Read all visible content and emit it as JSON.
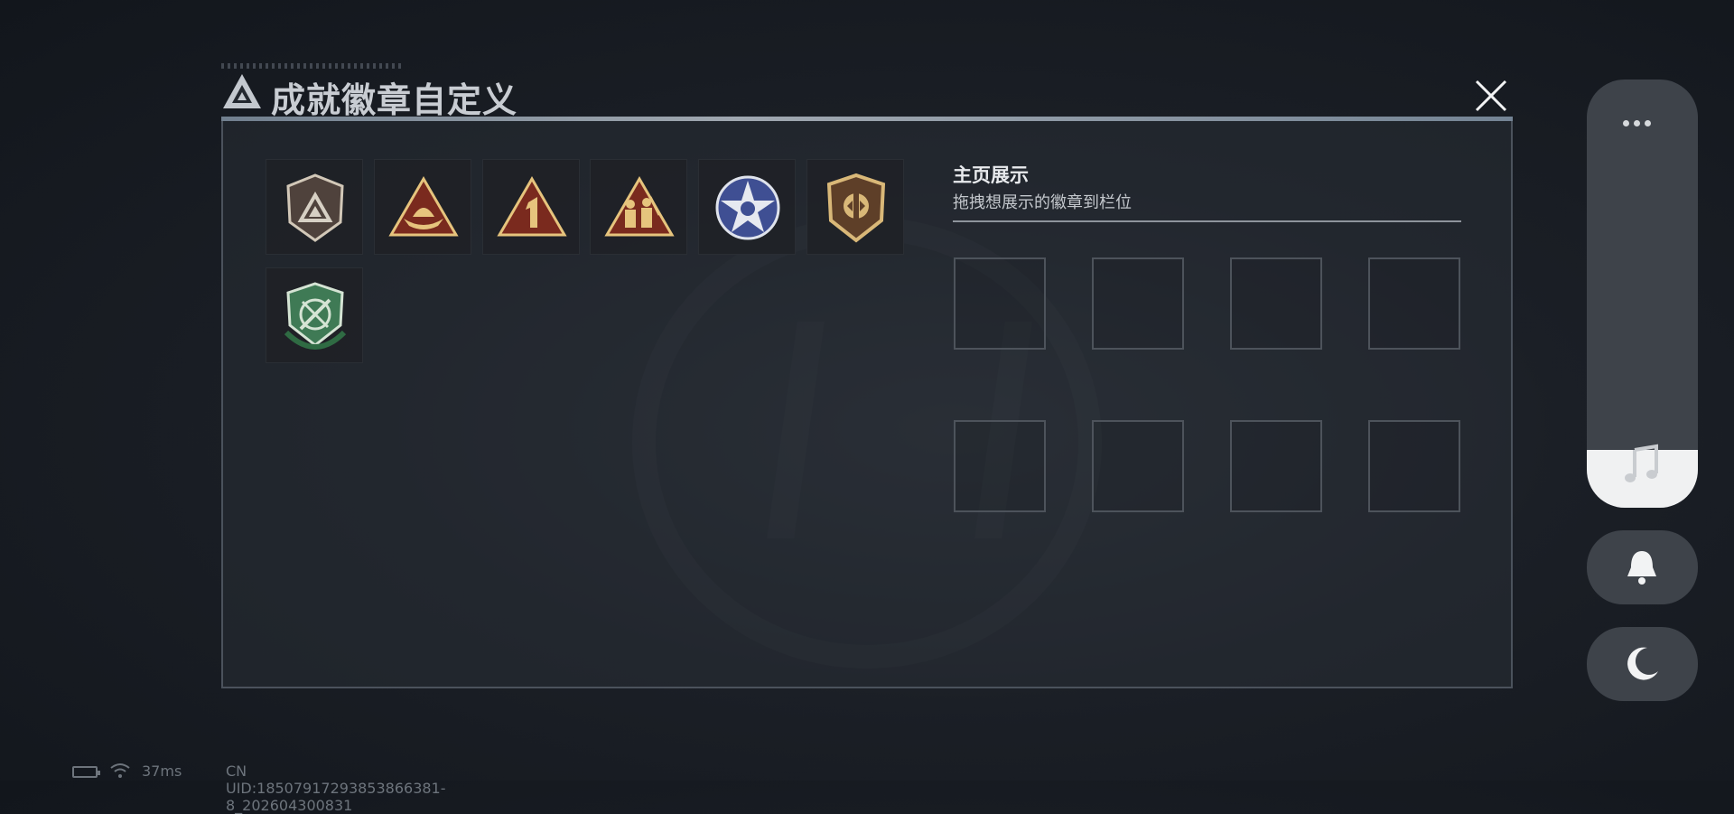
{
  "header": {
    "title": "成就徽章自定义",
    "close_icon": "close-icon"
  },
  "badges": [
    {
      "name": "badge-shield-grey-triangle",
      "colors": [
        "#5a4a43",
        "#cfc6b8"
      ]
    },
    {
      "name": "badge-triangle-boat",
      "colors": [
        "#7a2a1e",
        "#e3c27a"
      ]
    },
    {
      "name": "badge-triangle-number-one",
      "colors": [
        "#7a2a1e",
        "#e3c27a"
      ]
    },
    {
      "name": "badge-triangle-soldiers",
      "colors": [
        "#7a2a1e",
        "#e3c27a"
      ]
    },
    {
      "name": "badge-blue-star",
      "colors": [
        "#3f4f93",
        "#e4e7ee"
      ]
    },
    {
      "name": "badge-shield-gold-emblem",
      "colors": [
        "#6d4a2e",
        "#d8b77a"
      ]
    },
    {
      "name": "badge-green-shield-crossed",
      "colors": [
        "#3f7a55",
        "#d7e6d6"
      ]
    }
  ],
  "display": {
    "title": "主页展示",
    "subtitle": "拖拽想展示的徽章到栏位",
    "slots": 8
  },
  "side_menu": {
    "more_icon": "more-dots-icon",
    "music_icon": "music-note-icon",
    "bell_icon": "bell-icon",
    "moon_icon": "moon-icon"
  },
  "status_bar": {
    "ping": "37ms",
    "uid": "CN UID:18507917293853866381­8_202604300831"
  }
}
